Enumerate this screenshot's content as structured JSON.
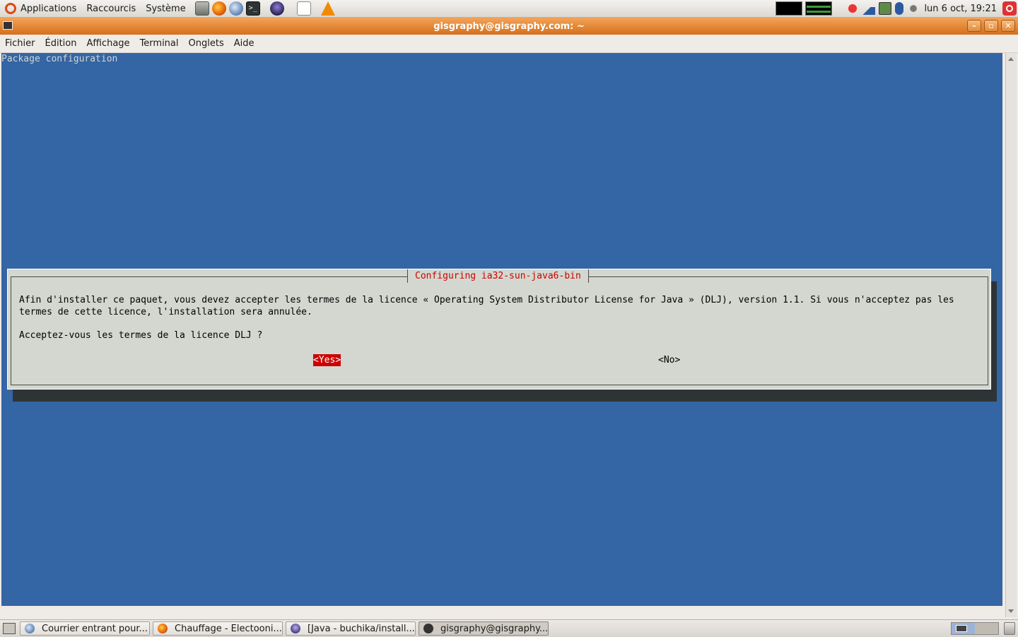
{
  "top_panel": {
    "menus": [
      "Applications",
      "Raccourcis",
      "Système"
    ],
    "clock": "lun  6 oct, 19:21"
  },
  "window": {
    "title": "gisgraphy@gisgraphy.com: ~",
    "buttons": {
      "minimize": "–",
      "maximize": "▫",
      "close": "✕"
    }
  },
  "menubar": {
    "items": [
      "Fichier",
      "Édition",
      "Affichage",
      "Terminal",
      "Onglets",
      "Aide"
    ]
  },
  "terminal": {
    "title": "Package configuration",
    "background": "#3465a4",
    "dialog": {
      "title": "Configuring ia32-sun-java6-bin",
      "message": "Afin d'installer ce paquet, vous devez accepter les termes de la licence « Operating System Distributor License for Java » (DLJ), version 1.1. Si vous n'acceptez pas les\ntermes de cette licence, l'installation sera annulée.",
      "question": "Acceptez-vous les termes de la licence DLJ ?",
      "yes_label": "<Yes>",
      "no_label": "<No>",
      "accent": "#cc0000"
    }
  },
  "taskbar": {
    "tasks": [
      {
        "label": "Courrier entrant pour...",
        "icon": "thunderbird-icon"
      },
      {
        "label": "Chauffage - Electooni...",
        "icon": "firefox-icon"
      },
      {
        "label": "[Java - buchika/install...",
        "icon": "eclipse-icon"
      },
      {
        "label": "gisgraphy@gisgraphy....",
        "icon": "terminal-icon"
      }
    ]
  }
}
